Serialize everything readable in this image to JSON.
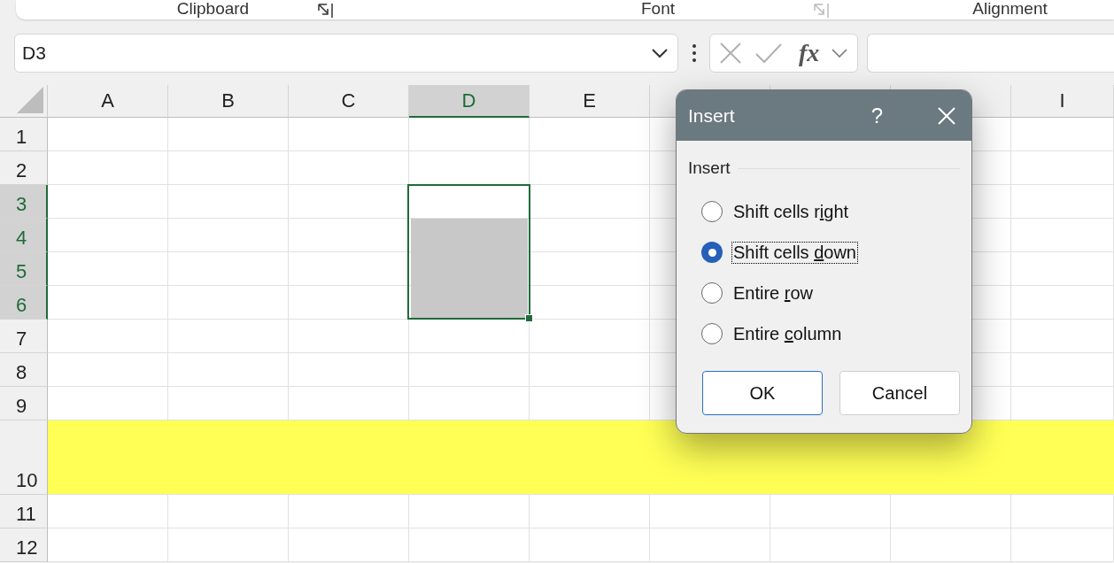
{
  "ribbon": {
    "groups": [
      {
        "label": "Clipboard",
        "launcher": true,
        "launcher_disabled": false
      },
      {
        "label": "Font",
        "launcher": true,
        "launcher_disabled": true
      },
      {
        "label": "Alignment"
      }
    ]
  },
  "name_box": {
    "value": "D3"
  },
  "formula_bar": {
    "buttons_disabled": true,
    "function_label": "fx"
  },
  "columns": [
    {
      "label": "A",
      "selected": false
    },
    {
      "label": "B",
      "selected": false
    },
    {
      "label": "C",
      "selected": false
    },
    {
      "label": "D",
      "selected": true
    },
    {
      "label": "E",
      "selected": false
    },
    {
      "selected": false
    },
    {
      "selected": false
    },
    {
      "selected": false
    },
    {
      "label": "I",
      "selected": false
    }
  ],
  "rows": [
    {
      "label": "1",
      "selected": false,
      "highlighted": false
    },
    {
      "label": "2",
      "selected": false,
      "highlighted": false
    },
    {
      "label": "3",
      "selected": true,
      "highlighted": false
    },
    {
      "label": "4",
      "selected": true,
      "highlighted": false
    },
    {
      "label": "5",
      "selected": true,
      "highlighted": false
    },
    {
      "label": "6",
      "selected": true,
      "highlighted": false
    },
    {
      "label": "7",
      "selected": false,
      "highlighted": false
    },
    {
      "label": "8",
      "selected": false,
      "highlighted": false
    },
    {
      "label": "9",
      "selected": false,
      "highlighted": false
    },
    {
      "label": "10",
      "selected": false,
      "highlighted": true
    },
    {
      "label": "11",
      "selected": false,
      "highlighted": false
    },
    {
      "label": "12",
      "selected": false,
      "highlighted": false
    }
  ],
  "dialog": {
    "title": "Insert",
    "help": "?",
    "group_label": "Insert",
    "options": [
      {
        "text_before": "Shift cells r",
        "access_key": "i",
        "text_after": "ght",
        "selected": false
      },
      {
        "text_before": "Shift cells ",
        "access_key": "d",
        "text_after": "own",
        "selected": true
      },
      {
        "text_before": "Entire ",
        "access_key": "r",
        "text_after": "ow",
        "selected": false
      },
      {
        "text_before": "Entire ",
        "access_key": "c",
        "text_after": "olumn",
        "selected": false
      }
    ],
    "buttons": [
      {
        "label": "OK",
        "default": true
      },
      {
        "label": "Cancel",
        "default": false
      }
    ]
  }
}
